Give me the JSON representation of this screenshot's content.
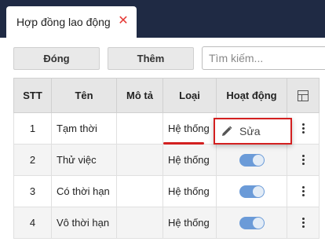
{
  "tab": {
    "title": "Hợp đồng lao động",
    "close_icon": "close-icon",
    "close_color": "#e53935"
  },
  "toolbar": {
    "close_label": "Đóng",
    "add_label": "Thêm",
    "search_placeholder": "Tìm kiếm..."
  },
  "table": {
    "headers": {
      "stt": "STT",
      "ten": "Tên",
      "mota": "Mô tả",
      "loai": "Loại",
      "hoatdong": "Hoạt động",
      "menu_icon": "table-columns-icon"
    },
    "rows": [
      {
        "stt": "1",
        "ten": "Tạm thời",
        "mota": "",
        "loai": "Hệ thống",
        "active": true
      },
      {
        "stt": "2",
        "ten": "Thử việc",
        "mota": "",
        "loai": "Hệ thống",
        "active": true
      },
      {
        "stt": "3",
        "ten": "Có thời hạn",
        "mota": "",
        "loai": "Hệ thống",
        "active": true
      },
      {
        "stt": "4",
        "ten": "Vô thời hạn",
        "mota": "",
        "loai": "Hệ thống",
        "active": true
      }
    ]
  },
  "context_menu": {
    "edit_label": "Sửa",
    "edit_icon": "pencil-icon",
    "highlight_color": "#d32020"
  },
  "colors": {
    "header_bg": "#1f2a44",
    "toggle_on": "#6b9bd8",
    "accent_red": "#d32020"
  }
}
